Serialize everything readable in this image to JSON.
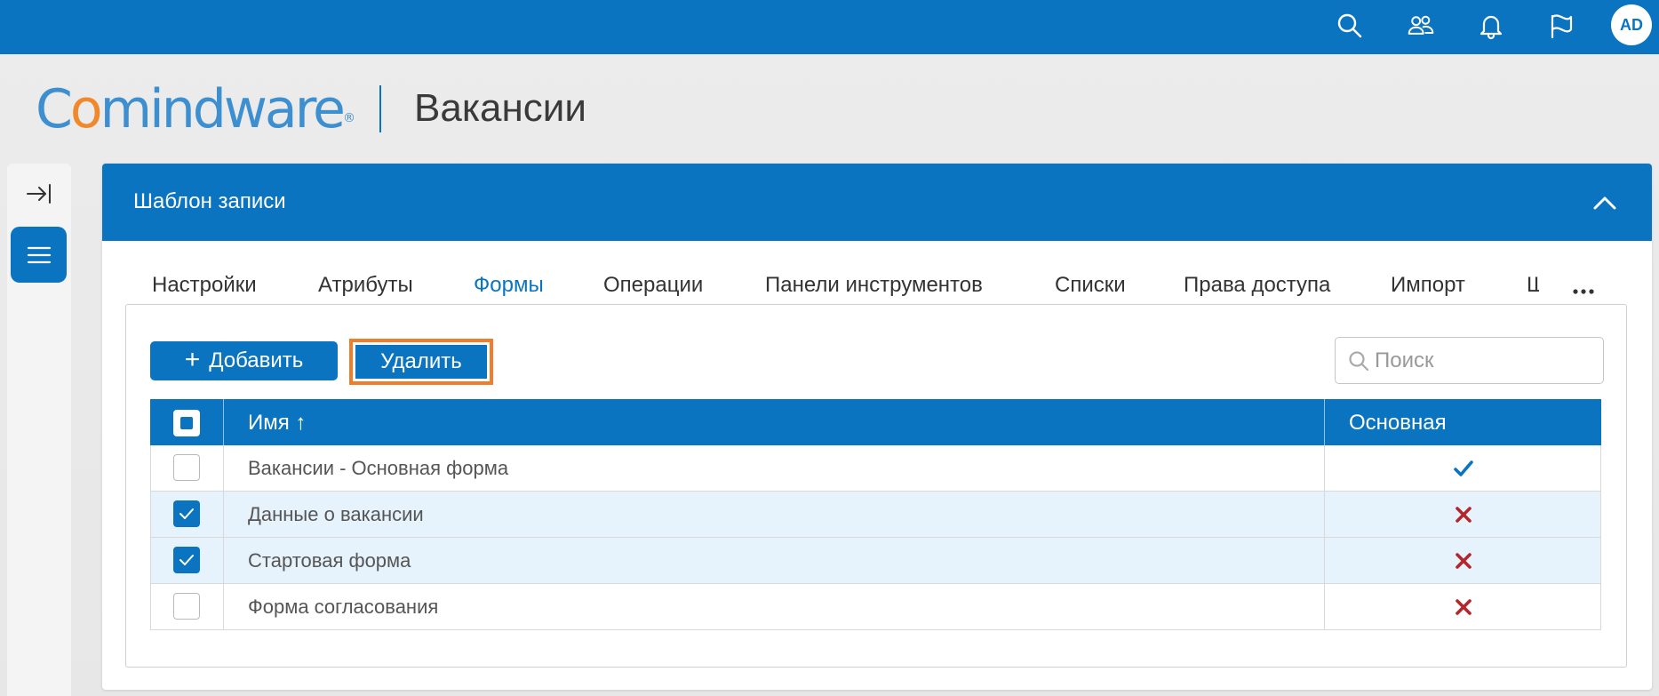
{
  "topbar": {
    "icons": [
      "search-icon",
      "users-icon",
      "bell-icon",
      "flag-icon"
    ],
    "avatar_initials": "AD"
  },
  "header": {
    "logo_text": {
      "c": "C",
      "o": "o",
      "rest": "mindware",
      "reg": "®"
    },
    "page_title": "Вакансии"
  },
  "panel": {
    "title": "Шаблон записи",
    "tabs": [
      {
        "label": "Настройки",
        "active": false
      },
      {
        "label": "Атрибуты",
        "active": false
      },
      {
        "label": "Формы",
        "active": true
      },
      {
        "label": "Операции",
        "active": false
      },
      {
        "label": "Панели инструментов",
        "active": false
      },
      {
        "label": "Списки",
        "active": false
      },
      {
        "label": "Права доступа",
        "active": false
      },
      {
        "label": "Импорт",
        "active": false
      },
      {
        "label": "Ш",
        "active": false
      }
    ]
  },
  "toolbar": {
    "add_label": "Добавить",
    "delete_label": "Удалить",
    "search_placeholder": "Поиск",
    "search_value": ""
  },
  "table": {
    "columns": {
      "name": "Имя ↑",
      "main": "Основная"
    },
    "rows": [
      {
        "name": "Вакансии - Основная форма",
        "checked": false,
        "main": true
      },
      {
        "name": "Данные о вакансии",
        "checked": true,
        "main": false
      },
      {
        "name": "Стартовая форма",
        "checked": true,
        "main": false
      },
      {
        "name": "Форма согласования",
        "checked": false,
        "main": false
      }
    ]
  },
  "colors": {
    "primary": "#0b74c0",
    "accent_orange": "#ee7d2c",
    "logo_blue": "#3d8fd0",
    "check_blue": "#0b74c0",
    "cross_red": "#b3262b",
    "selected_row": "#e7f3fc"
  }
}
